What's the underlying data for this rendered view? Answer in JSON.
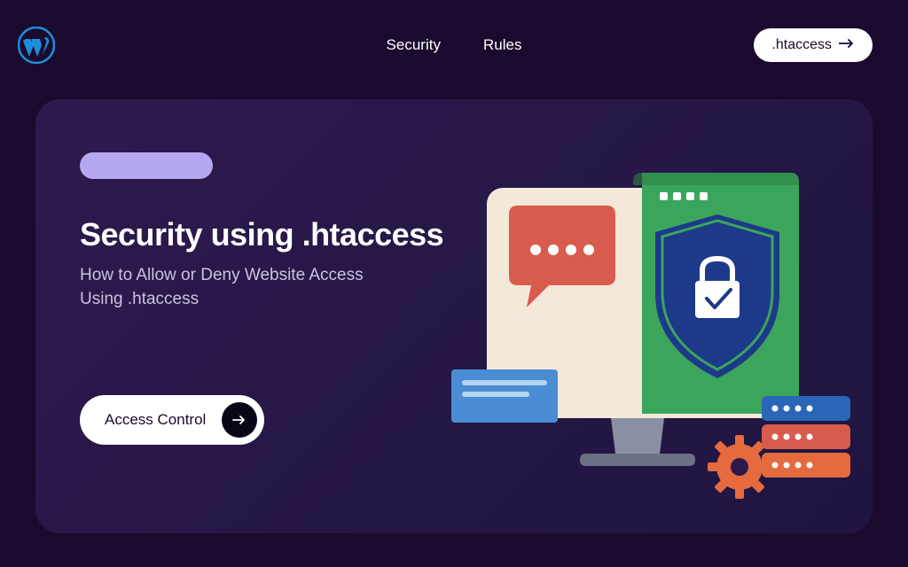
{
  "header": {
    "nav": {
      "link1": "Security",
      "link2": "Rules"
    },
    "cta_label": ".htaccess"
  },
  "hero": {
    "title": "Security using .htaccess",
    "subtitle": "How to Allow or Deny Website Access Using .htaccess",
    "button_label": "Access Control"
  },
  "colors": {
    "logo": "#1b8fda",
    "pill": "#b5a8f0",
    "card_bg": "#2d1a4d",
    "shield": "#1d3a8a",
    "green": "#3ba55c",
    "red": "#d85c4e",
    "orange": "#e56a3e",
    "blue": "#3a7ad4"
  }
}
